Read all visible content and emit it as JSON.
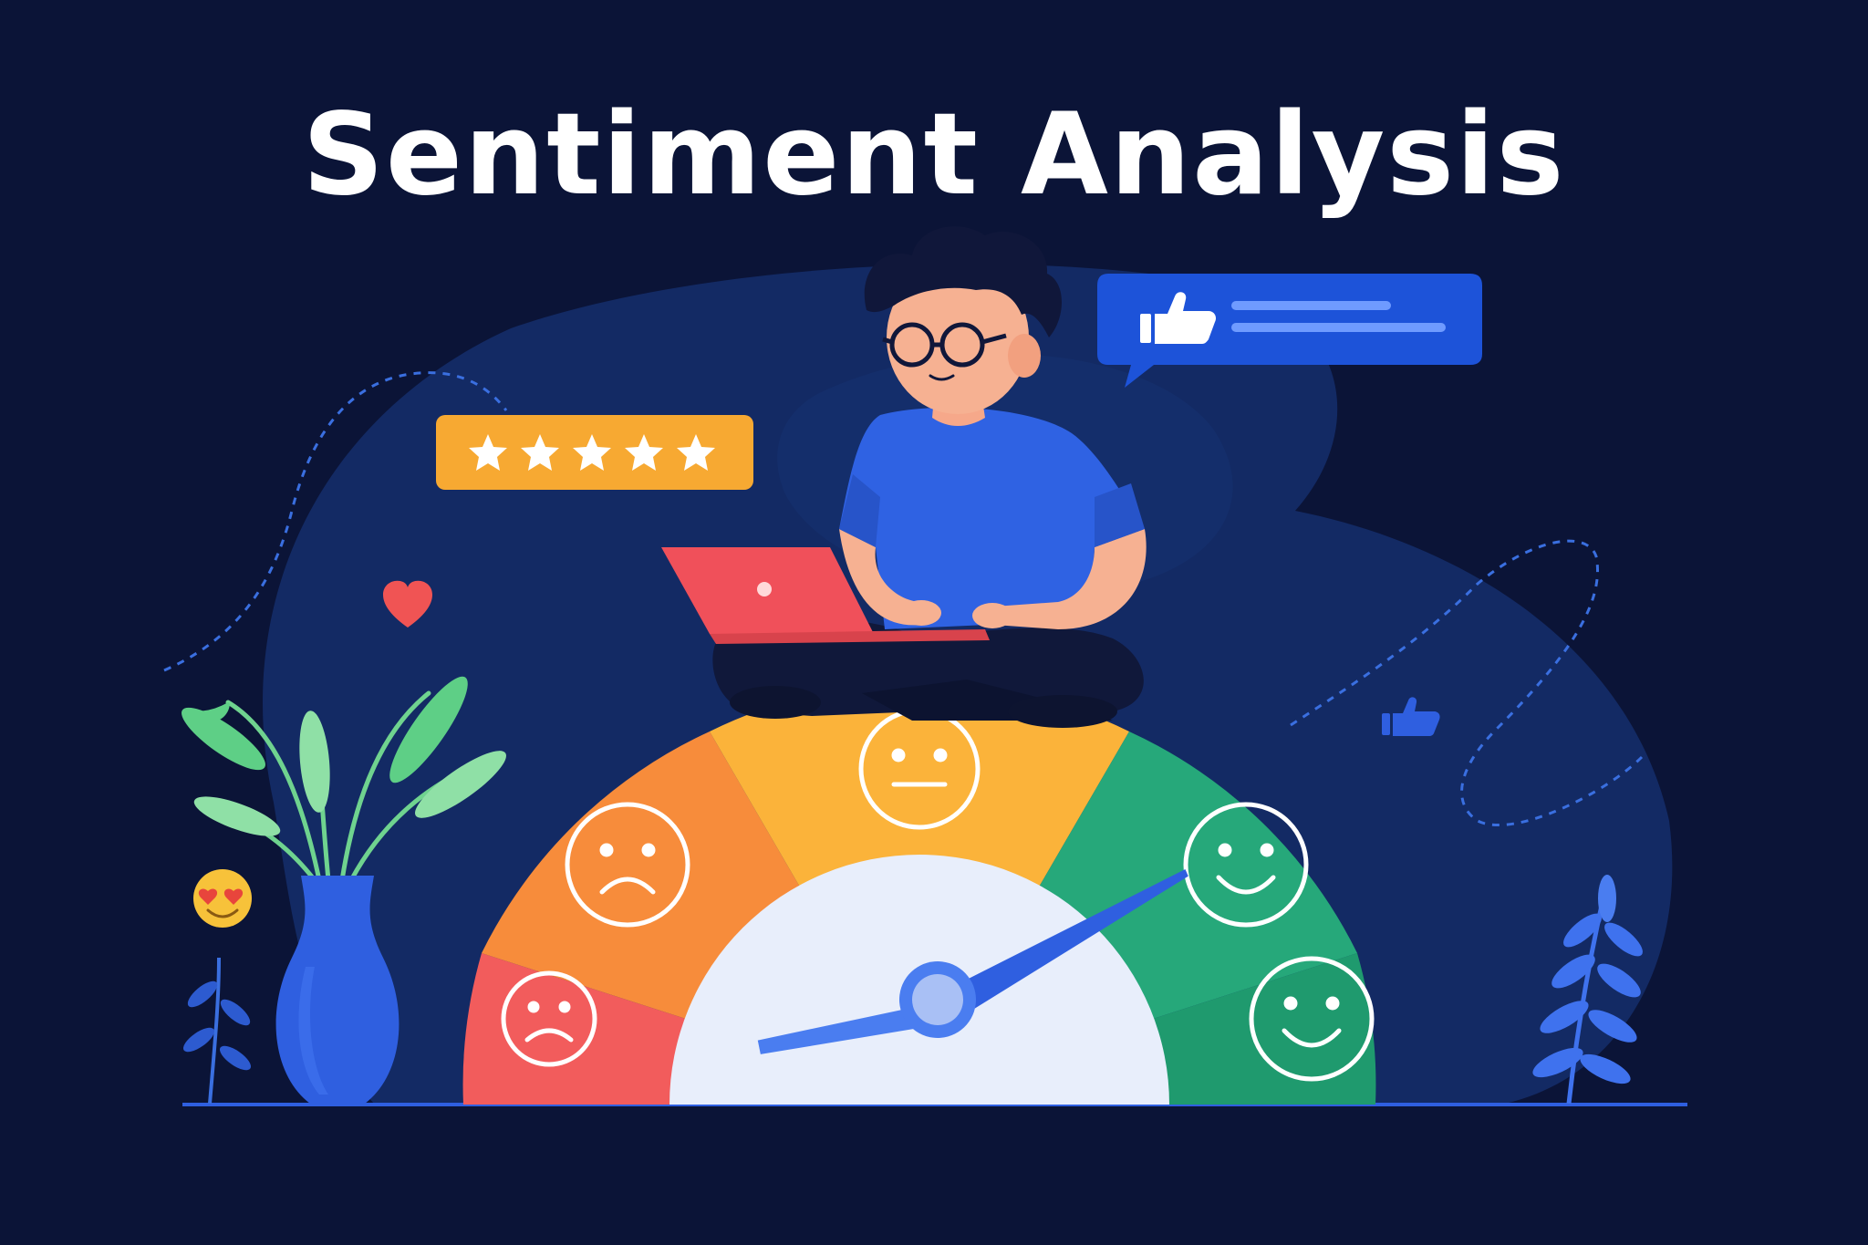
{
  "title": "Sentiment Analysis",
  "colors": {
    "background": "#0b1437",
    "blob": "#132a64",
    "gauge_red": "#f25c5c",
    "gauge_orange": "#f78c3b",
    "gauge_yellow": "#fbb33a",
    "gauge_green": "#26a87a",
    "gauge_dark_green": "#1f9a6e",
    "dial_face": "#e8eefb",
    "needle": "#2f5fe0",
    "accent_blue": "#1d53d9",
    "star_badge": "#f7a932"
  },
  "gauge": {
    "segments": [
      {
        "name": "very-negative",
        "icon": "sad-face-icon"
      },
      {
        "name": "negative",
        "icon": "sad-face-icon"
      },
      {
        "name": "neutral",
        "icon": "neutral-face-icon"
      },
      {
        "name": "positive",
        "icon": "smile-face-icon"
      },
      {
        "name": "very-positive",
        "icon": "smile-face-icon"
      }
    ],
    "needle_level": 0.85
  },
  "rating": {
    "stars": 5,
    "filled": 5
  },
  "icons": [
    "thumbs-up-icon",
    "heart-icon",
    "star-icon",
    "laptop-icon",
    "emoji-love-icon",
    "plant-icon",
    "vase-icon"
  ]
}
